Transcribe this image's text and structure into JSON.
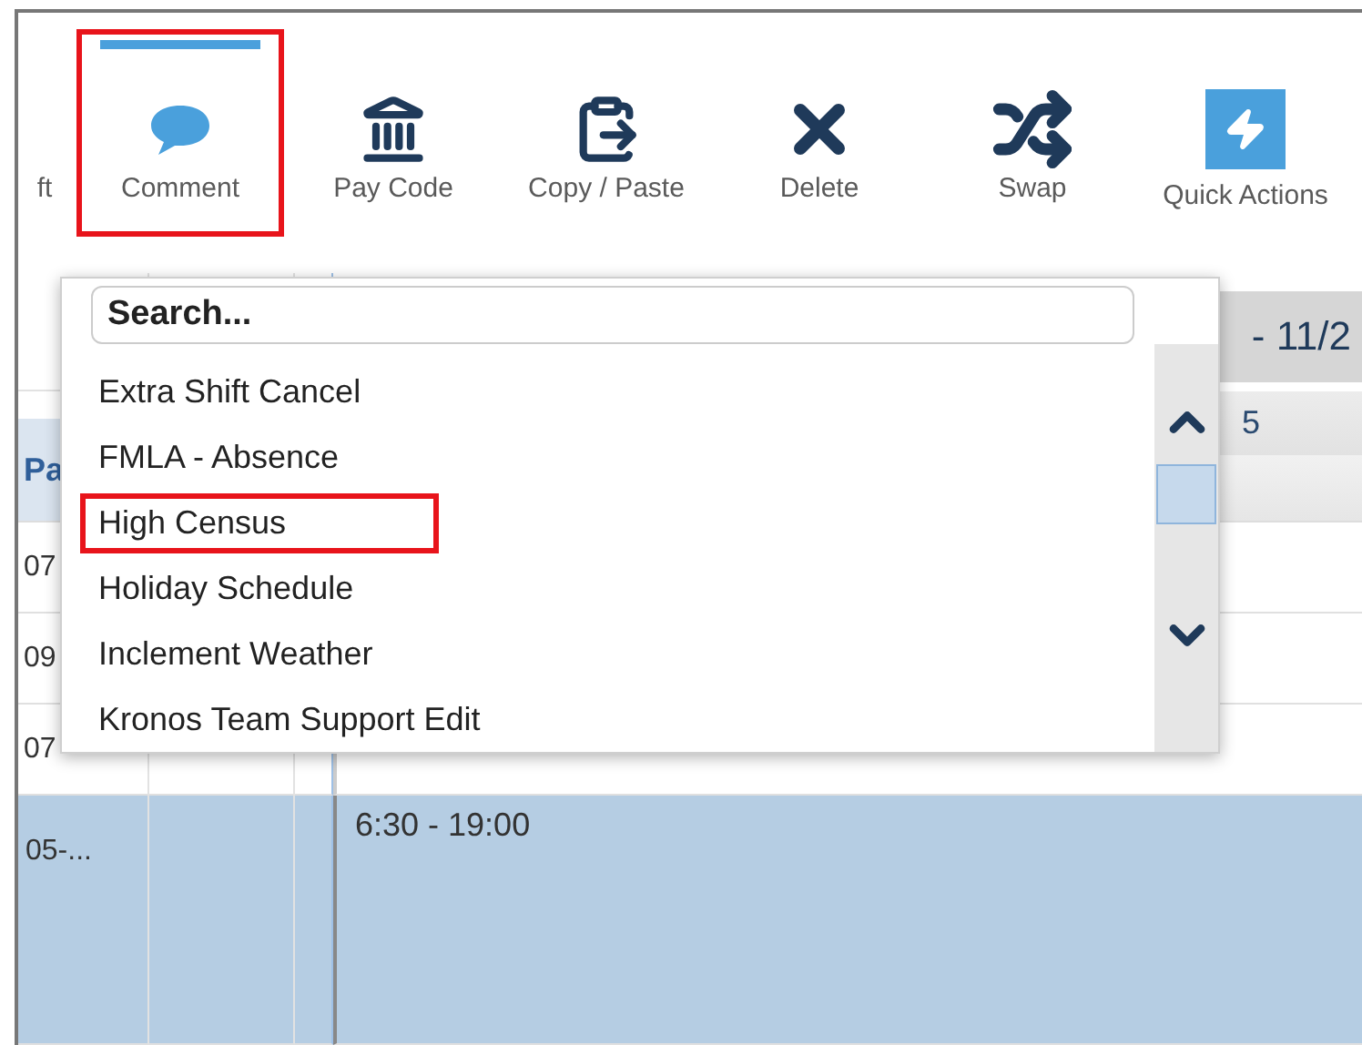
{
  "toolbar": {
    "items": [
      {
        "kind": "none",
        "label": "ft",
        "selected": false,
        "highlighted": false
      },
      {
        "kind": "comment",
        "label": "Comment",
        "selected": true,
        "highlighted": true
      },
      {
        "kind": "bank",
        "label": "Pay Code",
        "selected": false,
        "highlighted": false
      },
      {
        "kind": "paste",
        "label": "Copy / Paste",
        "selected": false,
        "highlighted": false
      },
      {
        "kind": "delete",
        "label": "Delete",
        "selected": false,
        "highlighted": false
      },
      {
        "kind": "swap",
        "label": "Swap",
        "selected": false,
        "highlighted": false
      },
      {
        "kind": "bolt",
        "label": "Quick Actions",
        "selected": false,
        "highlighted": false
      }
    ]
  },
  "schedule": {
    "date_range": "- 11/2",
    "day_header": "5",
    "column_header": "Pa",
    "rows": [
      {
        "cell": "07",
        "shift": null,
        "selected": false
      },
      {
        "cell": "09",
        "shift": null,
        "selected": false
      },
      {
        "cell": "07",
        "shift": null,
        "selected": false
      },
      {
        "cell": "05-...",
        "shift": "6:30 - 19:00",
        "selected": true
      }
    ]
  },
  "dropdown": {
    "search": {
      "placeholder": "Search..."
    },
    "items": [
      {
        "label": "Extra Shift Cancel",
        "highlighted": false
      },
      {
        "label": "FMLA - Absence",
        "highlighted": false
      },
      {
        "label": "High Census",
        "highlighted": true
      },
      {
        "label": "Holiday Schedule",
        "highlighted": false
      },
      {
        "label": "Inclement Weather",
        "highlighted": false
      },
      {
        "label": "Kronos Team Support Edit",
        "highlighted": false
      }
    ]
  }
}
